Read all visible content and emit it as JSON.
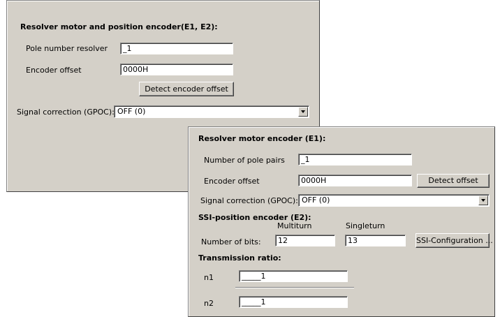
{
  "panel1": {
    "heading": "Resolver motor and position encoder(E1, E2):",
    "pole_label": "Pole number resolver",
    "pole_value": "_1",
    "offset_label": "Encoder offset",
    "offset_value": "0000H",
    "detect_button": "Detect encoder offset",
    "signal_label": "Signal correction (GPOC):",
    "signal_value": "OFF (0)"
  },
  "panel2": {
    "heading": "Resolver motor encoder (E1):",
    "pole_pairs_label": "Number of pole pairs",
    "pole_pairs_value": "_1",
    "offset_label": "Encoder offset",
    "offset_value": "0000H",
    "detect_button": "Detect offset",
    "signal_label": "Signal correction (GPOC):",
    "signal_value": "OFF (0)",
    "ssi_heading": "SSI-position encoder (E2):",
    "multiturn_label": "Multiturn",
    "singleturn_label": "Singleturn",
    "bits_label": "Number of bits:",
    "multiturn_value": "12",
    "singleturn_value": "13",
    "ssi_button": "SSI-Configuration ...",
    "ratio_heading": "Transmission ratio:",
    "n1_label": "n1",
    "n1_value": "_____1",
    "n2_label": "n2",
    "n2_value": "_____1"
  }
}
